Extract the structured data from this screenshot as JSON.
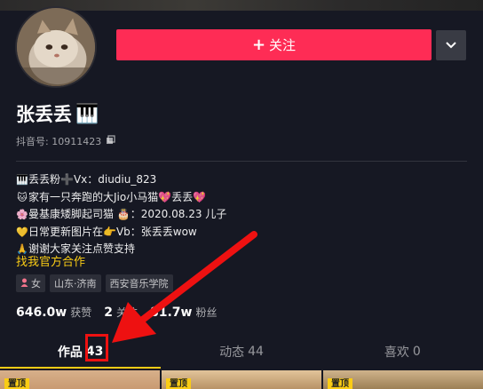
{
  "header": {
    "follow_label": "关注",
    "follow_plus": "+"
  },
  "profile": {
    "nickname": "张丢丢",
    "nickname_emoji": "🎹",
    "uid_label": "抖音号: 10911423"
  },
  "bio": {
    "lines": [
      {
        "emoji": "🎹",
        "text": "丢丢粉➕Vx：diudiu_823"
      },
      {
        "emoji": "🐱",
        "text": "家有一只奔跑的大Jio小马猫💖丢丢💖"
      },
      {
        "emoji": "🌸",
        "text": "曼基康矮脚起司猫 🎂：2020.08.23 儿子"
      },
      {
        "emoji": "💛",
        "text": "日常更新图片在👉Vb：张丢丢wow"
      },
      {
        "emoji": "🙏",
        "text": "谢谢大家关注点赞支持"
      }
    ],
    "official_link": "找我官方合作"
  },
  "tags": {
    "gender": "女",
    "location": "山东·济南",
    "school": "西安音乐学院"
  },
  "stats": {
    "likes_num": "646.0w",
    "likes_label": "获赞",
    "following_num": "2",
    "following_label": "关注",
    "followers_num": "81.7w",
    "followers_label": "粉丝"
  },
  "tabs": [
    {
      "label": "作品",
      "count": "43"
    },
    {
      "label": "动态",
      "count": "44"
    },
    {
      "label": "喜欢",
      "count": "0"
    }
  ],
  "thumbs": {
    "pin_label": "置顶"
  },
  "colors": {
    "accent": "#fe2c55",
    "tab_underline": "#facc15",
    "link": "#facc15",
    "annotation": "#ee1111"
  },
  "icons": {
    "more": "chevron-down-icon",
    "copy": "copy-icon",
    "gender": "female-icon"
  }
}
